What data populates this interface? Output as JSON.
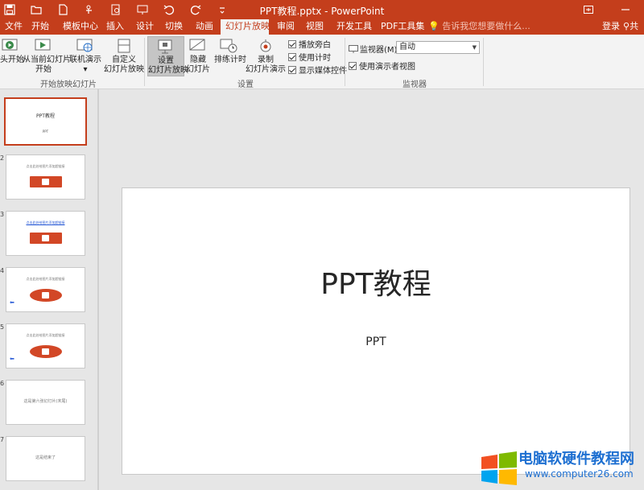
{
  "window": {
    "title": "PPT教程.pptx - PowerPoint",
    "qat_icons": [
      "save-icon",
      "open-icon",
      "new-icon",
      "touch-mode-icon",
      "print-preview-icon",
      "slideshow-icon",
      "undo-icon",
      "redo-icon",
      "customize-icon"
    ],
    "controls": [
      "ribbon-display-icon",
      "minimize-icon"
    ]
  },
  "tabs": [
    {
      "label": "文件",
      "active": false
    },
    {
      "label": "开始",
      "active": false
    },
    {
      "label": "模板中心",
      "active": false
    },
    {
      "label": "插入",
      "active": false
    },
    {
      "label": "设计",
      "active": false
    },
    {
      "label": "切换",
      "active": false
    },
    {
      "label": "动画",
      "active": false
    },
    {
      "label": "幻灯片放映",
      "active": true
    },
    {
      "label": "审阅",
      "active": false
    },
    {
      "label": "视图",
      "active": false
    },
    {
      "label": "开发工具",
      "active": false
    },
    {
      "label": "PDF工具集",
      "active": false
    }
  ],
  "tellme": "告诉我您想要做什么...",
  "account": {
    "login": "登录",
    "share": "共"
  },
  "ribbon": {
    "start_group": {
      "from_beginning": "头开始",
      "from_current_line1": "从当前幻灯片",
      "from_current_line2": "开始",
      "online_line1": "联机演示",
      "custom_line1": "自定义",
      "custom_line2": "幻灯片放映",
      "label": "开始放映幻灯片"
    },
    "setup_group": {
      "setup_line1": "设置",
      "setup_line2": "幻灯片放映",
      "hide_line1": "隐藏",
      "hide_line2": "幻灯片",
      "rehearse": "排练计时",
      "record_line1": "录制",
      "record_line2": "幻灯片演示",
      "play_narration": "播放旁白",
      "use_timings": "使用计时",
      "show_media_controls": "显示媒体控件",
      "label": "设置"
    },
    "monitor_group": {
      "monitor_label": "监视器(M):",
      "monitor_value": "自动",
      "presenter_view": "使用演示者视图",
      "label": "监视器"
    }
  },
  "thumbnails": [
    {
      "num": "",
      "title": "PPT教程",
      "sub": "PPT"
    },
    {
      "num": "2",
      "text": "点击此处给图片添加超链接"
    },
    {
      "num": "3",
      "text": "点击此处给图片添加超链接"
    },
    {
      "num": "4",
      "text": "点击此处给图片添加超链接"
    },
    {
      "num": "5",
      "text": "点击此处给图片添加超链接"
    },
    {
      "num": "6",
      "text": "这是第六张幻灯片(末尾)"
    },
    {
      "num": "7",
      "text": "这是结束了"
    }
  ],
  "slide": {
    "title": "PPT教程",
    "subtitle": "PPT"
  },
  "watermark": {
    "title": "电脑软硬件教程网",
    "url": "www.computer26.com"
  }
}
